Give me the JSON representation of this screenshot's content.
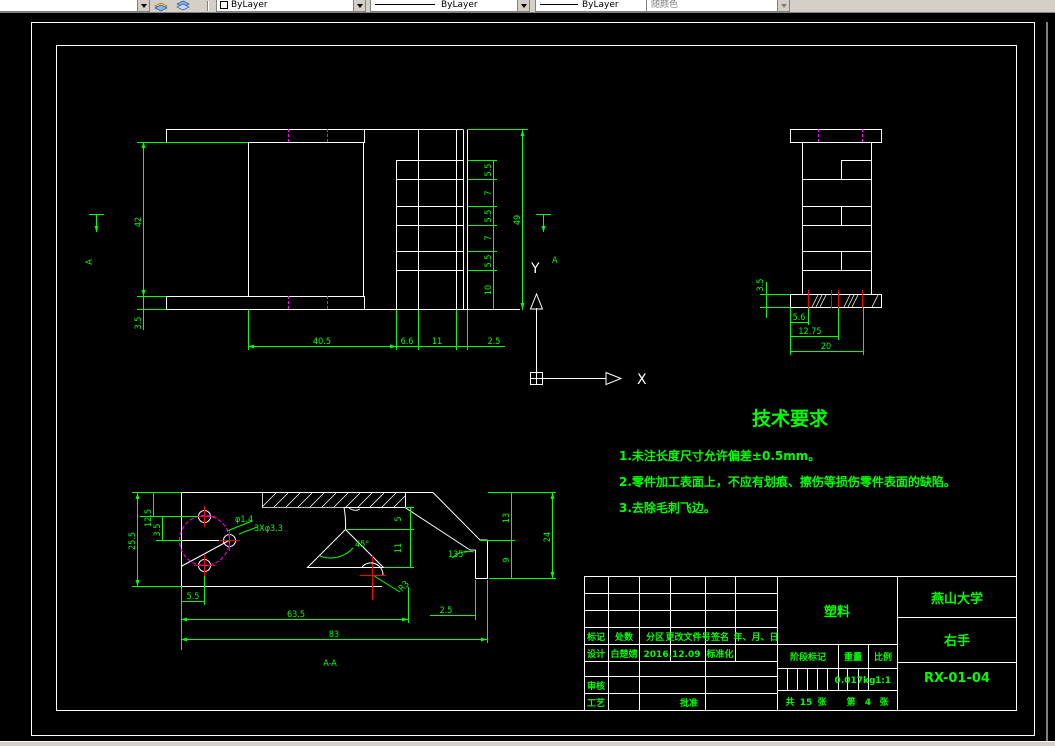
{
  "toolbar": {
    "layer_color": "ByLayer",
    "linetype": "ByLayer",
    "lineweight": "ByLayer",
    "plot_style": "随颜色"
  },
  "colors": {
    "background": "#000000",
    "geometry": "#ffffff",
    "dimension": "#00ff00",
    "centerline_hidden": "#ff00ff",
    "section": "#ff0000",
    "ucs": "#ffffff"
  },
  "drawing": {
    "front_view": {
      "dims": {
        "d42": "42",
        "d40_5": "40.5",
        "d6_6": "6.6",
        "d11": "11",
        "d2_5": "2.5",
        "d3_5": "3.5",
        "d49": "49",
        "s5_5a": "5.5",
        "s7a": "7",
        "s5_5b": "5.5",
        "s7b": "7",
        "s5_5c": "5.5",
        "s10": "10"
      },
      "section_mark_left": "A",
      "section_mark_right": "A"
    },
    "side_view": {
      "dims": {
        "d3_5": "3.5",
        "d5_6": "5.6",
        "d12_75": "12.75",
        "d20": "20"
      }
    },
    "ucs": {
      "y_label": "Y",
      "x_label": "X"
    },
    "section_view": {
      "dims": {
        "d12_5": "12.5",
        "d3_5": "3.5",
        "d25_5": "25.5",
        "d5_5": "5.5",
        "d63_5": "63.5",
        "d83": "83",
        "d2_5": "2.5",
        "d5": "5",
        "d11": "11",
        "d13": "13",
        "d9": "9",
        "d24": "24",
        "a45": "45°",
        "a135": "135°",
        "phi1": "φ1.4",
        "phi2": "3Xφ3.3",
        "r63": "R3"
      },
      "label": "A-A"
    },
    "tech_requirements": {
      "title": "技术要求",
      "items": [
        "1.未注长度尺寸允许偏差±0.5mm。",
        "2.零件加工表面上，不应有划痕、擦伤等损伤零件表面的缺陷。",
        "3.去除毛刺飞边。"
      ]
    },
    "title_block": {
      "material": "塑料",
      "university": "燕山大学",
      "part_name": "右手",
      "drawing_no": "RX-01-04",
      "h_mark": "标记",
      "h_count": "处数",
      "h_zone": "分区",
      "h_docno": "更改文件号",
      "h_sign": "签名",
      "h_date": "年、月、日",
      "r_design": "设计",
      "designer": "白楚婧",
      "design_date": "2016.12.09",
      "h_standard": "标准化",
      "r_review": "审核",
      "r_process": "工艺",
      "h_approve": "批准",
      "h_stage": "阶段标记",
      "h_weight": "重量",
      "h_scale": "比例",
      "weight": "0.017kg",
      "scale": "1:1",
      "total": "共",
      "total_n": "15",
      "zhang1": "张",
      "di": "第",
      "sheet_n": "4",
      "zhang2": "张"
    }
  }
}
